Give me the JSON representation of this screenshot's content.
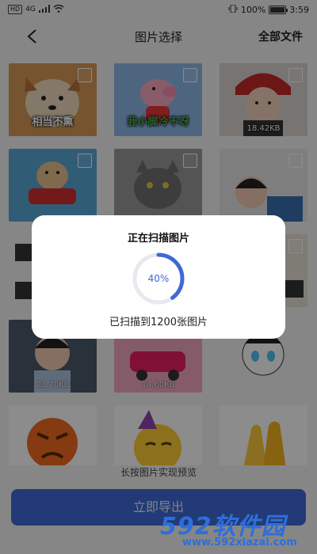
{
  "status_bar": {
    "hd": "HD",
    "signal": "4G",
    "battery_text": "100%",
    "time": "3:59"
  },
  "header": {
    "title": "图片选择",
    "right_action": "全部文件"
  },
  "tiles": [
    {
      "caption": "相当不熏",
      "size": ""
    },
    {
      "caption": "我小脚冷不呀",
      "size": ""
    },
    {
      "caption": "",
      "size": "18.42KB"
    },
    {
      "caption": "",
      "size": ""
    },
    {
      "caption": "",
      "size": ""
    },
    {
      "caption": "",
      "size": ""
    },
    {
      "caption": "",
      "size": ""
    },
    {
      "caption": "",
      "size": ""
    },
    {
      "caption": "",
      "size": ""
    },
    {
      "caption": "",
      "size": "23.78KB"
    },
    {
      "caption": "",
      "size": "14.60KB"
    },
    {
      "caption": "",
      "size": ""
    },
    {
      "caption": "",
      "size": ""
    },
    {
      "caption": "",
      "size": ""
    },
    {
      "caption": "",
      "size": ""
    }
  ],
  "hint": "长按图片实现预览",
  "import_button": "立即导出",
  "dialog": {
    "title": "正在扫描图片",
    "progress_label": "40%",
    "progress_value": 0.4,
    "message": "已扫描到1200张图片"
  },
  "watermark": {
    "main": "592软件园",
    "url": "www.592xiazai.com"
  },
  "colors": {
    "accent": "#3e6ad6",
    "watermark": "#2d6edc"
  }
}
